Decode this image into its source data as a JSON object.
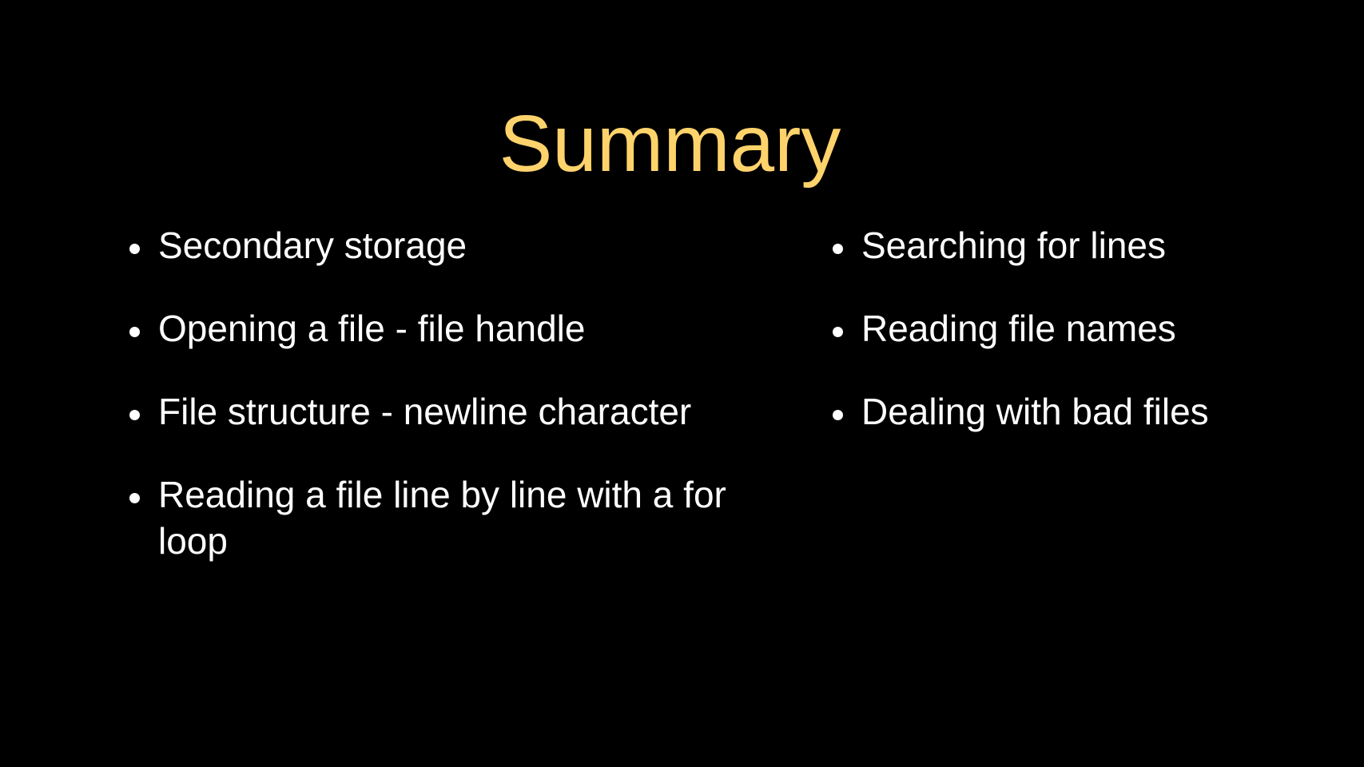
{
  "slide": {
    "title": "Summary",
    "left_bullets": [
      "Secondary storage",
      "Opening a file - file handle",
      "File structure - newline character",
      "Reading a file line by line with a for loop"
    ],
    "right_bullets": [
      "Searching for lines",
      "Reading file names",
      "Dealing with bad files"
    ],
    "colors": {
      "background": "#000000",
      "title": "#FFD36B",
      "text": "#FFFFFF"
    }
  }
}
